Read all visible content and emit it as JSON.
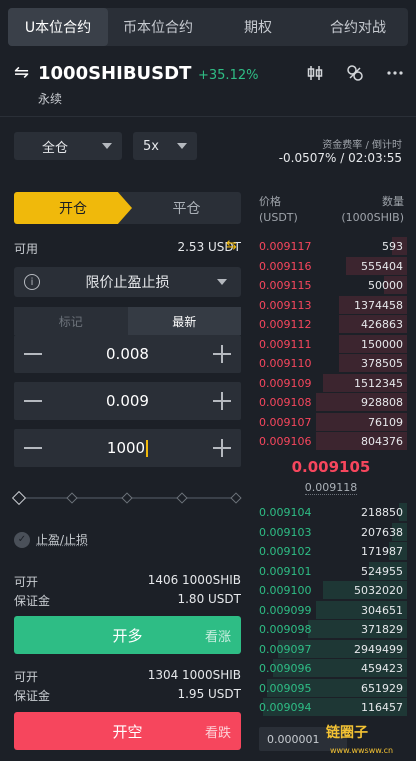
{
  "top_tabs": [
    "U本位合约",
    "币本位合约",
    "期权",
    "合约对战"
  ],
  "header": {
    "symbol": "1000SHIBUSDT",
    "change": "+35.12%",
    "subtitle": "永续",
    "icons": [
      "swap-icon",
      "candlestick-icon",
      "link-icon",
      "more-icon"
    ]
  },
  "position": {
    "margin_mode": "全仓",
    "leverage": "5x",
    "funding_label": "资金费率 / 倒计时",
    "funding_value": "-0.0507% / 02:03:55"
  },
  "order_form": {
    "open_tab": "开仓",
    "close_tab": "平仓",
    "available_label": "可用",
    "available_value": "2.53 USDT",
    "order_type": "限价止盈止损",
    "price_tabs": [
      "标记",
      "最新"
    ],
    "trigger_price": "0.008",
    "limit_price": "0.009",
    "amount": "1000",
    "tpsl_label": "止盈/止损",
    "long": {
      "open_label": "可开",
      "open_value": "1406 1000SHIB",
      "margin_label": "保证金",
      "margin_value": "1.80 USDT",
      "button": "开多",
      "button_sub": "看涨"
    },
    "short": {
      "open_label": "可开",
      "open_value": "1304 1000SHIB",
      "margin_label": "保证金",
      "margin_value": "1.95 USDT",
      "button": "开空",
      "button_sub": "看跌"
    }
  },
  "order_book": {
    "price_header": "价格",
    "price_unit": "(USDT)",
    "qty_header": "数量",
    "qty_unit": "(1000SHIB)",
    "asks": [
      {
        "price": "0.009117",
        "qty": "593",
        "depth": 0.1
      },
      {
        "price": "0.009116",
        "qty": "555404",
        "depth": 0.4
      },
      {
        "price": "0.009115",
        "qty": "50000",
        "depth": 0.15
      },
      {
        "price": "0.009113",
        "qty": "1374458",
        "depth": 0.45
      },
      {
        "price": "0.009112",
        "qty": "426863",
        "depth": 0.45
      },
      {
        "price": "0.009111",
        "qty": "150000",
        "depth": 0.45
      },
      {
        "price": "0.009110",
        "qty": "378505",
        "depth": 0.45
      },
      {
        "price": "0.009109",
        "qty": "1512345",
        "depth": 0.55
      },
      {
        "price": "0.009108",
        "qty": "928808",
        "depth": 0.6
      },
      {
        "price": "0.009107",
        "qty": "76109",
        "depth": 0.6
      },
      {
        "price": "0.009106",
        "qty": "804376",
        "depth": 0.6
      }
    ],
    "last_price": "0.009105",
    "mark_price": "0.009118",
    "bids": [
      {
        "price": "0.009104",
        "qty": "218850",
        "depth": 0.05
      },
      {
        "price": "0.009103",
        "qty": "207638",
        "depth": 0.1
      },
      {
        "price": "0.009102",
        "qty": "171987",
        "depth": 0.12
      },
      {
        "price": "0.009101",
        "qty": "524955",
        "depth": 0.25
      },
      {
        "price": "0.009100",
        "qty": "5032020",
        "depth": 0.55
      },
      {
        "price": "0.009099",
        "qty": "304651",
        "depth": 0.6
      },
      {
        "price": "0.009098",
        "qty": "371829",
        "depth": 0.65
      },
      {
        "price": "0.009097",
        "qty": "2949499",
        "depth": 0.85
      },
      {
        "price": "0.009096",
        "qty": "459423",
        "depth": 0.88
      },
      {
        "price": "0.009095",
        "qty": "651929",
        "depth": 0.92
      },
      {
        "price": "0.009094",
        "qty": "116457",
        "depth": 0.95
      }
    ],
    "precision": "0.000001"
  },
  "watermark": {
    "brand": "链圈子",
    "url": "www.wwsww.cn"
  },
  "colors": {
    "up": "#2ebd85",
    "down": "#f6465d",
    "accent": "#f0b90b",
    "bg": "#1c2027"
  }
}
